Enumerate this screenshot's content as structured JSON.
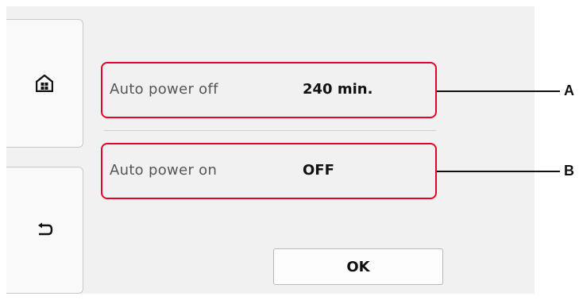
{
  "settings": [
    {
      "label": "Auto power off",
      "value": "240 min."
    },
    {
      "label": "Auto power on",
      "value": "OFF"
    }
  ],
  "ok_label": "OK",
  "callouts": {
    "a": "A",
    "b": "B"
  },
  "icons": {
    "home": "home-icon",
    "back": "back-arrow-icon"
  },
  "colors": {
    "highlight": "#e8002a",
    "screen_bg": "#f1f1f1"
  }
}
